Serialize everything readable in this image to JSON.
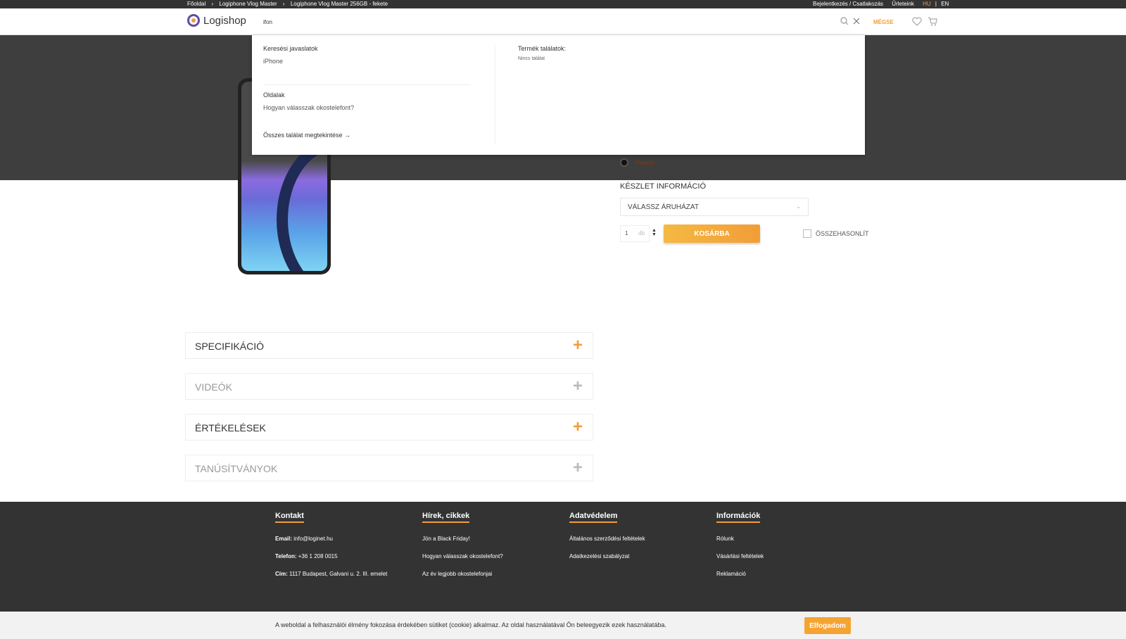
{
  "topbar": {
    "breadcrumbs": [
      "Főoldal",
      "›",
      "Logiphone Vlog Master",
      "›",
      "Logiphone Vlog Master 256GB - fekete"
    ],
    "login": "Bejelentkezés / Csatlakozás",
    "forms": "Űrleteink",
    "lang_hu": "HU",
    "lang_sep": "|",
    "lang_en": "EN"
  },
  "header": {
    "logo_text": "Logishop",
    "search_value": "ifon",
    "cancel_label": "MÉGSE"
  },
  "dropdown": {
    "suggestions_title": "Keresési javaslatok",
    "suggestion": "iPhone",
    "pages_title": "Oldalak",
    "page_link": "Hogyan válasszak okostelefont?",
    "view_all": "Összes találat megtekintése →",
    "products_title": "Termék találatok:",
    "no_result": "Nincs találat"
  },
  "product": {
    "color_name": "Fekete",
    "stock_title": "KÉSZLET INFORMÁCIÓ",
    "store_select": "VÁLASSZ ÁRUHÁZAT",
    "qty_value": "1",
    "qty_unit": "db",
    "add_to_cart": "KOSÁRBA",
    "compare_label": "ÖSSZEHASONLÍT"
  },
  "accordions": [
    {
      "label": "SPECIFIKÁCIÓ",
      "state": "active"
    },
    {
      "label": "VIDEÓK",
      "state": "muted"
    },
    {
      "label": "ÉRTÉKELÉSEK",
      "state": "active"
    },
    {
      "label": "TANÚSÍTVÁNYOK",
      "state": "muted"
    }
  ],
  "footer": {
    "contact": {
      "title": "Kontakt",
      "email_label": "Email:",
      "email": "info@loginet.hu",
      "phone_label": "Telefon:",
      "phone": "+36 1 208 0015",
      "address_label": "Cím:",
      "address": "1117 Budapest, Galvani u. 2. III. emelet"
    },
    "news": {
      "title": "Hírek, cikkek",
      "links": [
        "Jön a Black Friday!",
        "Hogyan válasszak okostelefont?",
        "Az év legjobb okostelefonjai"
      ]
    },
    "privacy": {
      "title": "Adatvédelem",
      "links": [
        "Általános szerződési feltételek",
        "Adatkezelési szabályzat"
      ]
    },
    "info": {
      "title": "Információk",
      "links": [
        "Rólunk",
        "Vásárlási feltételek",
        "Reklamáció"
      ]
    }
  },
  "cookie": {
    "text": "A weboldal a felhasználói élmény fokozása érdekében sütiket (cookie) alkalmaz. Az oldal használatával Ön beleegyezik ezek használatába.",
    "accept": "Elfogadom"
  },
  "colors": {
    "accent": "#f29d38",
    "dark": "#333333",
    "brand": "#5b4ea5"
  }
}
